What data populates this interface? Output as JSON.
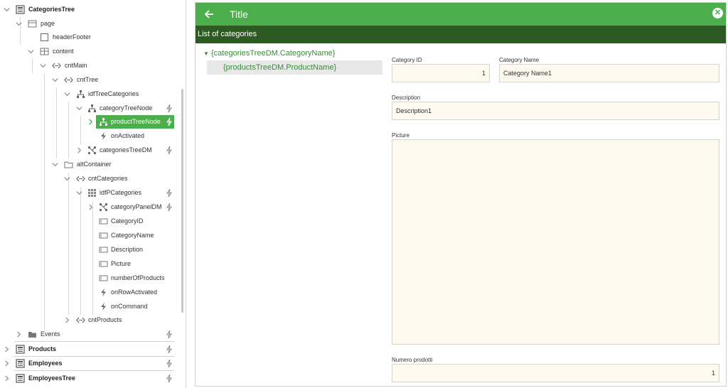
{
  "tree": {
    "rows": [
      {
        "label": "CategoriesTree",
        "icon": "page-icon",
        "chevron": "down"
      },
      {
        "label": "page",
        "icon": "layout-icon",
        "chevron": "down"
      },
      {
        "label": "headerFooter",
        "icon": "checkbox-icon",
        "chevron": ""
      },
      {
        "label": "content",
        "icon": "layout-grid-icon",
        "chevron": "down"
      },
      {
        "label": "cntMain",
        "icon": "container-icon",
        "chevron": "down"
      },
      {
        "label": "cntTree",
        "icon": "container-icon",
        "chevron": "down"
      },
      {
        "label": "idfTreeCategories",
        "icon": "tree-icon",
        "chevron": "down"
      },
      {
        "label": "categoryTreeNode",
        "icon": "tree-icon",
        "chevron": "down"
      },
      {
        "label": "productTreeNode",
        "icon": "tree-icon",
        "chevron": "right"
      },
      {
        "label": "onActivated",
        "icon": "bolt-icon",
        "chevron": ""
      },
      {
        "label": "categoriesTreeDM",
        "icon": "datamap-icon",
        "chevron": "right"
      },
      {
        "label": "altContainer",
        "icon": "folder-outline-icon",
        "chevron": "down"
      },
      {
        "label": "cntCategories",
        "icon": "container-icon",
        "chevron": "down"
      },
      {
        "label": "idfPCategories",
        "icon": "panel-grid-icon",
        "chevron": "down"
      },
      {
        "label": "categoryPanelDM",
        "icon": "datamap-icon",
        "chevron": "right"
      },
      {
        "label": "CategoryID",
        "icon": "field-icon",
        "chevron": ""
      },
      {
        "label": "CategoryName",
        "icon": "field-icon",
        "chevron": ""
      },
      {
        "label": "Description",
        "icon": "field-icon",
        "chevron": ""
      },
      {
        "label": "Picture",
        "icon": "field-icon",
        "chevron": ""
      },
      {
        "label": "numberOfProducts",
        "icon": "field-icon",
        "chevron": ""
      },
      {
        "label": "onRowActivated",
        "icon": "bolt-icon",
        "chevron": ""
      },
      {
        "label": "onCommand",
        "icon": "bolt-icon",
        "chevron": ""
      },
      {
        "label": "cntProducts",
        "icon": "container-icon",
        "chevron": "right"
      },
      {
        "label": "Events",
        "icon": "folder-icon",
        "chevron": "right"
      },
      {
        "label": "Products",
        "icon": "page-icon",
        "chevron": "right"
      },
      {
        "label": "Employees",
        "icon": "page-icon",
        "chevron": "right"
      },
      {
        "label": "EmployeesTree",
        "icon": "page-icon",
        "chevron": "right"
      }
    ]
  },
  "preview": {
    "title": "Title",
    "back_icon": "arrow-left-icon",
    "close_icon": "close-circle-icon",
    "subheader": "List of categories",
    "tree_root": "{categoriesTreeDM.CategoryName}",
    "tree_child": "{productsTreeDM.ProductName}",
    "fields": {
      "category_id": {
        "label": "Category ID",
        "value": "1"
      },
      "category_name": {
        "label": "Category Name",
        "value": "Category Name1"
      },
      "description": {
        "label": "Description",
        "value": "Description1"
      },
      "picture": {
        "label": "Picture",
        "value": ""
      },
      "numero_prodotti": {
        "label": "Numero prodotti",
        "value": "1"
      }
    }
  },
  "colors": {
    "accent_green": "#4cae4c",
    "dark_green": "#2d5a22",
    "field_bg": "#fdf9ef",
    "tree_text_green": "#3b8a3b"
  }
}
